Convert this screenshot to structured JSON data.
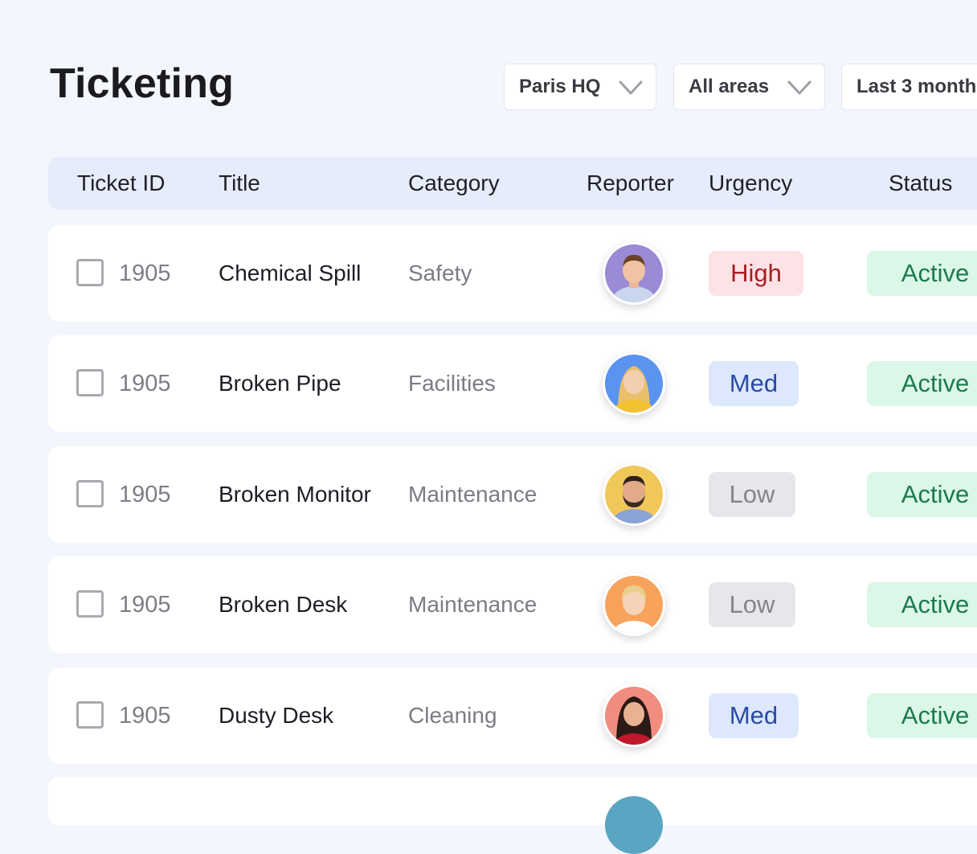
{
  "page": {
    "title": "Ticketing"
  },
  "filters": [
    {
      "label": "Paris HQ",
      "icon": "chevron-down-icon"
    },
    {
      "label": "All areas",
      "icon": "chevron-down-icon"
    },
    {
      "label": "Last 3 month"
    }
  ],
  "table": {
    "columns": [
      "Ticket ID",
      "Title",
      "Category",
      "Reporter",
      "Urgency",
      "Status"
    ],
    "rows": [
      {
        "id": "1905",
        "title": "Chemical Spill",
        "category": "Safety",
        "avatar_bg": "#9b8ad6",
        "urgency": "High",
        "status": "Active"
      },
      {
        "id": "1905",
        "title": "Broken Pipe",
        "category": "Facilities",
        "avatar_bg": "#5b93f0",
        "urgency": "Med",
        "status": "Active"
      },
      {
        "id": "1905",
        "title": "Broken Monitor",
        "category": "Maintenance",
        "avatar_bg": "#f0c85a",
        "urgency": "Low",
        "status": "Active"
      },
      {
        "id": "1905",
        "title": "Broken Desk",
        "category": "Maintenance",
        "avatar_bg": "#f7a35c",
        "urgency": "Low",
        "status": "Active"
      },
      {
        "id": "1905",
        "title": "Dusty Desk",
        "category": "Cleaning",
        "avatar_bg": "#f08d7e",
        "urgency": "Med",
        "status": "Active"
      }
    ]
  },
  "colors": {
    "background": "#f4f6fd",
    "header_bg": "#e7ecfb",
    "urgency_high_bg": "#fde3e5",
    "urgency_high_text": "#a81f22",
    "urgency_med_bg": "#dde8fd",
    "urgency_med_text": "#2a4aa6",
    "urgency_low_bg": "#e6e7ea",
    "urgency_low_text": "#84858c",
    "status_active_bg": "#dbf7e7",
    "status_active_text": "#1c7a4c"
  }
}
